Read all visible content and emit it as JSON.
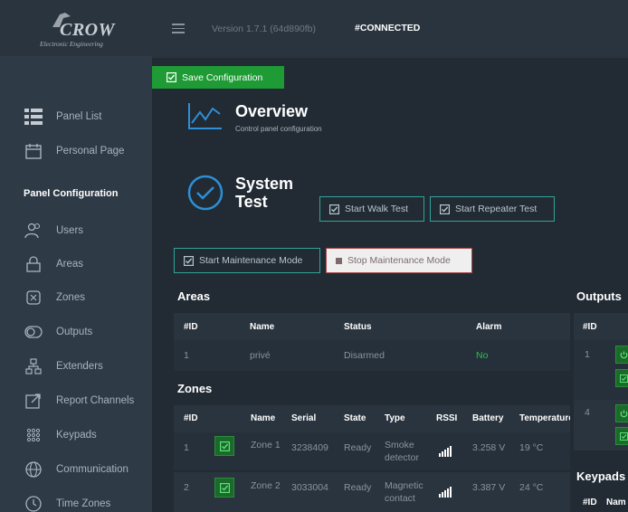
{
  "logo": {
    "word": "CROW",
    "subtitle": "Electronic Engineering"
  },
  "topbar": {
    "version": "Version 1.7.1 (64d890fb)",
    "status": "#CONNECTED"
  },
  "toolbar": {
    "save_label": "Save Configuration"
  },
  "sidebar": {
    "items_top": [
      {
        "label": "Panel List",
        "icon": "list-icon"
      },
      {
        "label": "Personal Page",
        "icon": "calendar-icon"
      }
    ],
    "section_title": "Panel Configuration",
    "items": [
      {
        "label": "Users",
        "icon": "users-icon"
      },
      {
        "label": "Areas",
        "icon": "lock-icon"
      },
      {
        "label": "Zones",
        "icon": "zone-icon"
      },
      {
        "label": "Outputs",
        "icon": "toggle-icon"
      },
      {
        "label": "Extenders",
        "icon": "sitemap-icon"
      },
      {
        "label": "Report Channels",
        "icon": "report-icon"
      },
      {
        "label": "Keypads",
        "icon": "keypad-icon"
      },
      {
        "label": "Communication",
        "icon": "globe-icon"
      },
      {
        "label": "Time Zones",
        "icon": "clock-icon"
      }
    ]
  },
  "overview": {
    "title": "Overview",
    "subtitle": "Control panel configuration"
  },
  "system_test": {
    "title": "System Test",
    "walk_test_label": "Start Walk Test",
    "repeater_test_label": "Start Repeater Test",
    "start_maintenance_label": "Start Maintenance Mode",
    "stop_maintenance_label": "Stop Maintenance Mode"
  },
  "areas": {
    "title": "Areas",
    "headers": [
      "#ID",
      "Name",
      "Status",
      "Alarm"
    ],
    "rows": [
      {
        "id": "1",
        "name": "privé",
        "status": "Disarmed",
        "alarm": "No"
      }
    ]
  },
  "zones": {
    "title": "Zones",
    "headers": [
      "#ID",
      "Name",
      "Serial",
      "State",
      "Type",
      "RSSI",
      "Battery",
      "Temperature"
    ],
    "rows": [
      {
        "id": "1",
        "name": "Zone 1",
        "serial": "3238409",
        "state": "Ready",
        "type": "Smoke detector",
        "battery": "3.258 V",
        "temperature": "19 °C"
      },
      {
        "id": "2",
        "name": "Zone 2",
        "serial": "3033004",
        "state": "Ready",
        "type": "Magnetic contact",
        "battery": "3.387 V",
        "temperature": "24 °C"
      }
    ]
  },
  "outputs": {
    "title": "Outputs",
    "headers": [
      "#ID"
    ],
    "rows": [
      {
        "id": "1"
      },
      {
        "id": "4"
      }
    ]
  },
  "keypads": {
    "title": "Keypads",
    "headers": [
      "#ID",
      "Nam"
    ]
  },
  "colors": {
    "accent_green": "#1e9b35",
    "outline_teal": "#2fa39a",
    "alarm_no": "#23c24a",
    "stop_red": "#a84a4a"
  }
}
